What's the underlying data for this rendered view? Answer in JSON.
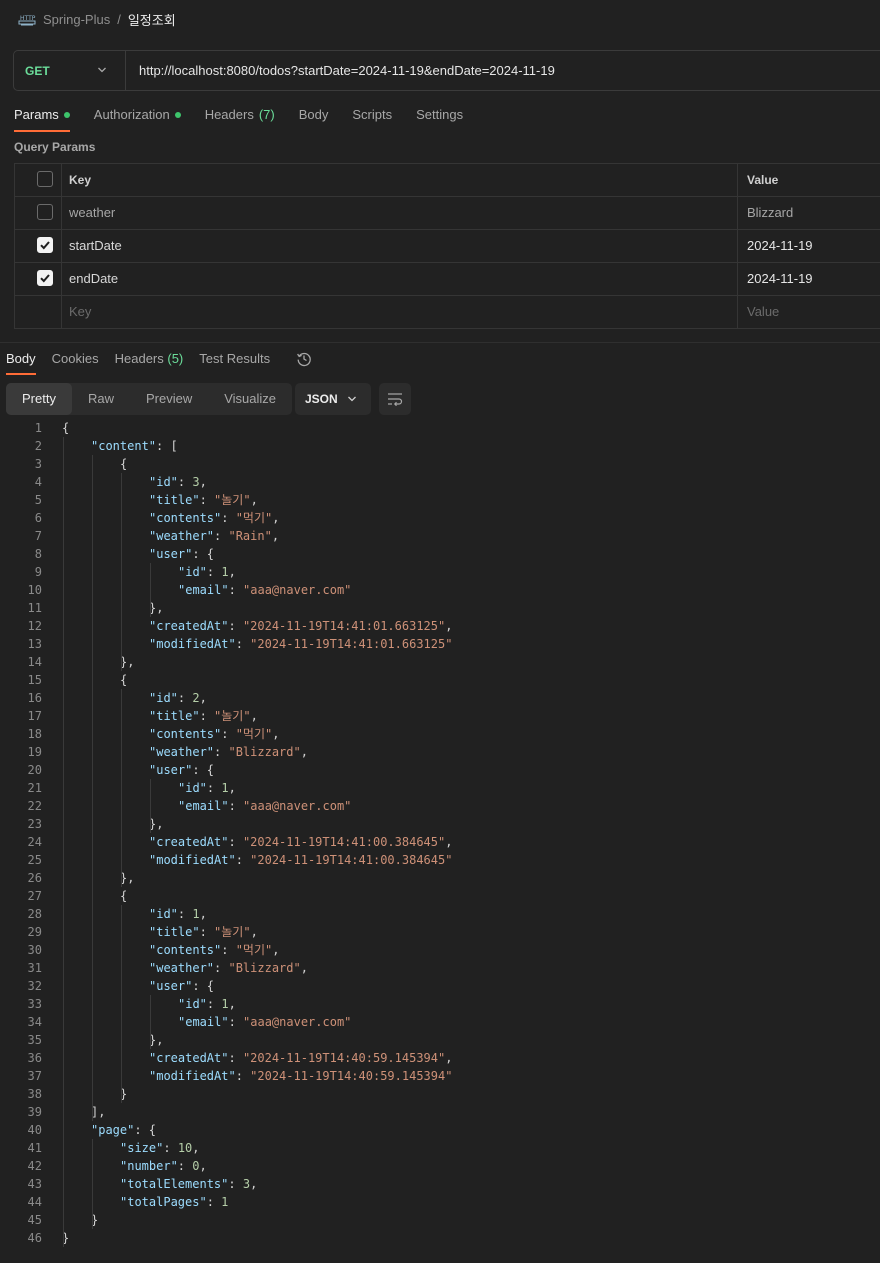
{
  "breadcrumb": {
    "icon": "http-icon",
    "parent": "Spring-Plus",
    "separator": "/",
    "current": "일정조회"
  },
  "request": {
    "method": "GET",
    "url": "http://localhost:8080/todos?startDate=2024-11-19&endDate=2024-11-19"
  },
  "request_tabs": [
    {
      "label": "Params",
      "dot": true,
      "active": true
    },
    {
      "label": "Authorization",
      "dot": true
    },
    {
      "label": "Headers",
      "count": "(7)"
    },
    {
      "label": "Body"
    },
    {
      "label": "Scripts"
    },
    {
      "label": "Settings"
    }
  ],
  "query_params": {
    "title": "Query Params",
    "header": {
      "key": "Key",
      "value": "Value"
    },
    "rows": [
      {
        "key": "weather",
        "value": "Blizzard",
        "checked": false
      },
      {
        "key": "startDate",
        "value": "2024-11-19",
        "checked": true
      },
      {
        "key": "endDate",
        "value": "2024-11-19",
        "checked": true
      }
    ],
    "placeholder": {
      "key": "Key",
      "value": "Value"
    }
  },
  "response_tabs": [
    {
      "label": "Body",
      "active": true
    },
    {
      "label": "Cookies"
    },
    {
      "label": "Headers",
      "count": "(5)"
    },
    {
      "label": "Test Results"
    }
  ],
  "view_modes": [
    "Pretty",
    "Raw",
    "Preview",
    "Visualize"
  ],
  "active_view": "Pretty",
  "format": "JSON",
  "colors": {
    "accent": "#ff6c37",
    "method": "#6bdd9a",
    "key": "#9cdcfe",
    "string": "#ce9178",
    "number": "#b5cea8"
  },
  "code_lines": [
    [
      {
        "t": "p",
        "v": "{"
      }
    ],
    [
      {
        "t": "k",
        "v": "\"content\""
      },
      {
        "t": "p",
        "v": ": ["
      }
    ],
    [
      {
        "t": "p",
        "v": "{"
      }
    ],
    [
      {
        "t": "k",
        "v": "\"id\""
      },
      {
        "t": "p",
        "v": ": "
      },
      {
        "t": "n",
        "v": "3"
      },
      {
        "t": "p",
        "v": ","
      }
    ],
    [
      {
        "t": "k",
        "v": "\"title\""
      },
      {
        "t": "p",
        "v": ": "
      },
      {
        "t": "s",
        "v": "\"놀기\""
      },
      {
        "t": "p",
        "v": ","
      }
    ],
    [
      {
        "t": "k",
        "v": "\"contents\""
      },
      {
        "t": "p",
        "v": ": "
      },
      {
        "t": "s",
        "v": "\"먹기\""
      },
      {
        "t": "p",
        "v": ","
      }
    ],
    [
      {
        "t": "k",
        "v": "\"weather\""
      },
      {
        "t": "p",
        "v": ": "
      },
      {
        "t": "s",
        "v": "\"Rain\""
      },
      {
        "t": "p",
        "v": ","
      }
    ],
    [
      {
        "t": "k",
        "v": "\"user\""
      },
      {
        "t": "p",
        "v": ": {"
      }
    ],
    [
      {
        "t": "k",
        "v": "\"id\""
      },
      {
        "t": "p",
        "v": ": "
      },
      {
        "t": "n",
        "v": "1"
      },
      {
        "t": "p",
        "v": ","
      }
    ],
    [
      {
        "t": "k",
        "v": "\"email\""
      },
      {
        "t": "p",
        "v": ": "
      },
      {
        "t": "s",
        "v": "\"aaa@naver.com\""
      }
    ],
    [
      {
        "t": "p",
        "v": "},"
      }
    ],
    [
      {
        "t": "k",
        "v": "\"createdAt\""
      },
      {
        "t": "p",
        "v": ": "
      },
      {
        "t": "s",
        "v": "\"2024-11-19T14:41:01.663125\""
      },
      {
        "t": "p",
        "v": ","
      }
    ],
    [
      {
        "t": "k",
        "v": "\"modifiedAt\""
      },
      {
        "t": "p",
        "v": ": "
      },
      {
        "t": "s",
        "v": "\"2024-11-19T14:41:01.663125\""
      }
    ],
    [
      {
        "t": "p",
        "v": "},"
      }
    ],
    [
      {
        "t": "p",
        "v": "{"
      }
    ],
    [
      {
        "t": "k",
        "v": "\"id\""
      },
      {
        "t": "p",
        "v": ": "
      },
      {
        "t": "n",
        "v": "2"
      },
      {
        "t": "p",
        "v": ","
      }
    ],
    [
      {
        "t": "k",
        "v": "\"title\""
      },
      {
        "t": "p",
        "v": ": "
      },
      {
        "t": "s",
        "v": "\"놀기\""
      },
      {
        "t": "p",
        "v": ","
      }
    ],
    [
      {
        "t": "k",
        "v": "\"contents\""
      },
      {
        "t": "p",
        "v": ": "
      },
      {
        "t": "s",
        "v": "\"먹기\""
      },
      {
        "t": "p",
        "v": ","
      }
    ],
    [
      {
        "t": "k",
        "v": "\"weather\""
      },
      {
        "t": "p",
        "v": ": "
      },
      {
        "t": "s",
        "v": "\"Blizzard\""
      },
      {
        "t": "p",
        "v": ","
      }
    ],
    [
      {
        "t": "k",
        "v": "\"user\""
      },
      {
        "t": "p",
        "v": ": {"
      }
    ],
    [
      {
        "t": "k",
        "v": "\"id\""
      },
      {
        "t": "p",
        "v": ": "
      },
      {
        "t": "n",
        "v": "1"
      },
      {
        "t": "p",
        "v": ","
      }
    ],
    [
      {
        "t": "k",
        "v": "\"email\""
      },
      {
        "t": "p",
        "v": ": "
      },
      {
        "t": "s",
        "v": "\"aaa@naver.com\""
      }
    ],
    [
      {
        "t": "p",
        "v": "},"
      }
    ],
    [
      {
        "t": "k",
        "v": "\"createdAt\""
      },
      {
        "t": "p",
        "v": ": "
      },
      {
        "t": "s",
        "v": "\"2024-11-19T14:41:00.384645\""
      },
      {
        "t": "p",
        "v": ","
      }
    ],
    [
      {
        "t": "k",
        "v": "\"modifiedAt\""
      },
      {
        "t": "p",
        "v": ": "
      },
      {
        "t": "s",
        "v": "\"2024-11-19T14:41:00.384645\""
      }
    ],
    [
      {
        "t": "p",
        "v": "},"
      }
    ],
    [
      {
        "t": "p",
        "v": "{"
      }
    ],
    [
      {
        "t": "k",
        "v": "\"id\""
      },
      {
        "t": "p",
        "v": ": "
      },
      {
        "t": "n",
        "v": "1"
      },
      {
        "t": "p",
        "v": ","
      }
    ],
    [
      {
        "t": "k",
        "v": "\"title\""
      },
      {
        "t": "p",
        "v": ": "
      },
      {
        "t": "s",
        "v": "\"놀기\""
      },
      {
        "t": "p",
        "v": ","
      }
    ],
    [
      {
        "t": "k",
        "v": "\"contents\""
      },
      {
        "t": "p",
        "v": ": "
      },
      {
        "t": "s",
        "v": "\"먹기\""
      },
      {
        "t": "p",
        "v": ","
      }
    ],
    [
      {
        "t": "k",
        "v": "\"weather\""
      },
      {
        "t": "p",
        "v": ": "
      },
      {
        "t": "s",
        "v": "\"Blizzard\""
      },
      {
        "t": "p",
        "v": ","
      }
    ],
    [
      {
        "t": "k",
        "v": "\"user\""
      },
      {
        "t": "p",
        "v": ": {"
      }
    ],
    [
      {
        "t": "k",
        "v": "\"id\""
      },
      {
        "t": "p",
        "v": ": "
      },
      {
        "t": "n",
        "v": "1"
      },
      {
        "t": "p",
        "v": ","
      }
    ],
    [
      {
        "t": "k",
        "v": "\"email\""
      },
      {
        "t": "p",
        "v": ": "
      },
      {
        "t": "s",
        "v": "\"aaa@naver.com\""
      }
    ],
    [
      {
        "t": "p",
        "v": "},"
      }
    ],
    [
      {
        "t": "k",
        "v": "\"createdAt\""
      },
      {
        "t": "p",
        "v": ": "
      },
      {
        "t": "s",
        "v": "\"2024-11-19T14:40:59.145394\""
      },
      {
        "t": "p",
        "v": ","
      }
    ],
    [
      {
        "t": "k",
        "v": "\"modifiedAt\""
      },
      {
        "t": "p",
        "v": ": "
      },
      {
        "t": "s",
        "v": "\"2024-11-19T14:40:59.145394\""
      }
    ],
    [
      {
        "t": "p",
        "v": "}"
      }
    ],
    [
      {
        "t": "p",
        "v": "],"
      }
    ],
    [
      {
        "t": "k",
        "v": "\"page\""
      },
      {
        "t": "p",
        "v": ": {"
      }
    ],
    [
      {
        "t": "k",
        "v": "\"size\""
      },
      {
        "t": "p",
        "v": ": "
      },
      {
        "t": "n",
        "v": "10"
      },
      {
        "t": "p",
        "v": ","
      }
    ],
    [
      {
        "t": "k",
        "v": "\"number\""
      },
      {
        "t": "p",
        "v": ": "
      },
      {
        "t": "n",
        "v": "0"
      },
      {
        "t": "p",
        "v": ","
      }
    ],
    [
      {
        "t": "k",
        "v": "\"totalElements\""
      },
      {
        "t": "p",
        "v": ": "
      },
      {
        "t": "n",
        "v": "3"
      },
      {
        "t": "p",
        "v": ","
      }
    ],
    [
      {
        "t": "k",
        "v": "\"totalPages\""
      },
      {
        "t": "p",
        "v": ": "
      },
      {
        "t": "n",
        "v": "1"
      }
    ],
    [
      {
        "t": "p",
        "v": "}"
      }
    ],
    [
      {
        "t": "p",
        "v": "}"
      }
    ]
  ]
}
